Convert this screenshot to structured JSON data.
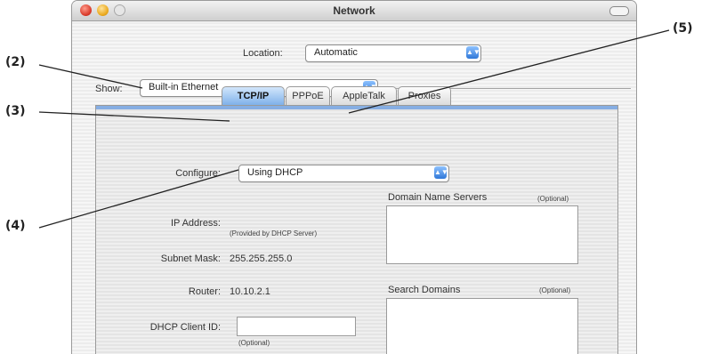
{
  "callouts": [
    "(2)",
    "(3)",
    "(4)",
    "(5)"
  ],
  "window": {
    "title": "Network",
    "location_label": "Location:",
    "location_value": "Automatic",
    "show_label": "Show:",
    "show_value": "Built-in Ethernet",
    "tabs": [
      "TCP/IP",
      "PPPoE",
      "AppleTalk",
      "Proxies"
    ],
    "configure_label": "Configure:",
    "configure_value": "Using DHCP",
    "ip_label": "IP Address:",
    "ip_note": "(Provided by DHCP Server)",
    "subnet_label": "Subnet Mask:",
    "subnet_value": "255.255.255.0",
    "router_label": "Router:",
    "router_value": "10.10.2.1",
    "dhcp_label": "DHCP Client ID:",
    "dhcp_value": "",
    "dhcp_note": "(Optional)",
    "dns_label": "Domain Name Servers",
    "dns_note": "(Optional)",
    "search_label": "Search Domains",
    "search_note": "(Optional)"
  }
}
